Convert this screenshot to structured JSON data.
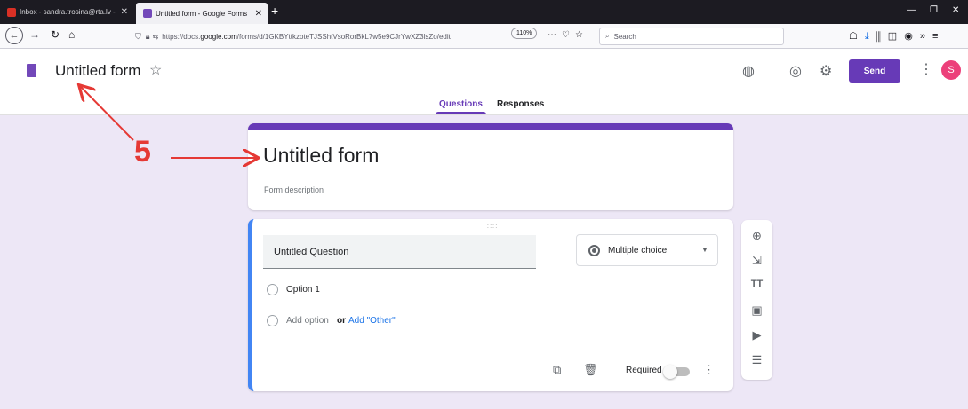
{
  "browser": {
    "tabs": [
      {
        "label": "Inbox - sandra.trosina@rta.lv - ",
        "active": false
      },
      {
        "label": "Untitled form - Google Forms",
        "active": true
      }
    ],
    "url_prefix": "https://docs.",
    "url_domain": "google.com",
    "url_suffix": "/forms/d/1GKBYttkzoteTJSShtVsoRorBkL7w5e9CJrYwXZ3lsZo/edit",
    "zoom": "110%",
    "search_placeholder": "Search"
  },
  "header": {
    "doc_title": "Untitled form",
    "send_label": "Send",
    "avatar_initial": "S",
    "tabs": [
      "Questions",
      "Responses"
    ]
  },
  "title_card": {
    "title": "Untitled form",
    "description_placeholder": "Form description"
  },
  "question": {
    "title": "Untitled Question",
    "type": "Multiple choice",
    "option1": "Option 1",
    "add_option": "Add option",
    "or": "or",
    "add_other": "Add \"Other\"",
    "required_label": "Required",
    "required": false
  },
  "annotation": {
    "number": "5"
  },
  "colors": {
    "accent": "#673ab7",
    "canvas_bg": "#ede7f6",
    "question_border": "#4285f4",
    "annotation": "#e53935"
  },
  "icons": [
    "gmail-icon",
    "forms-icon",
    "back-icon",
    "forward-icon",
    "reload-icon",
    "home-icon",
    "shield-icon",
    "lock-icon",
    "page-actions-icon",
    "pocket-icon",
    "bookmark-star-icon",
    "search-icon",
    "download-icon",
    "library-icon",
    "sidebar-icon",
    "account-icon",
    "overflow-icon",
    "hamburger-icon",
    "star-icon",
    "palette-icon",
    "preview-eye-icon",
    "settings-gear-icon",
    "more-vert-icon",
    "add-question-icon",
    "import-questions-icon",
    "add-title-icon",
    "add-image-icon",
    "add-video-icon",
    "add-section-icon",
    "duplicate-icon",
    "delete-icon"
  ]
}
